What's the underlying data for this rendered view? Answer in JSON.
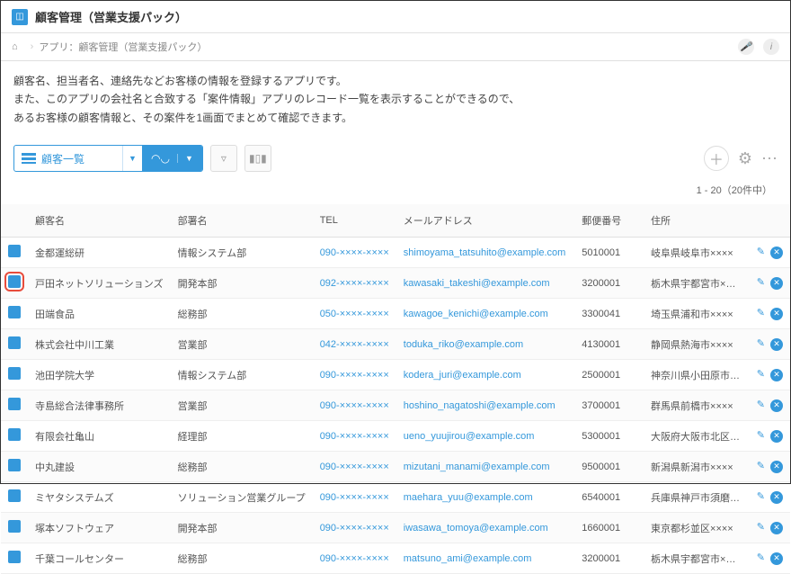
{
  "header": {
    "title": "顧客管理（営業支援パック）"
  },
  "breadcrumb": {
    "app_label": "アプリ：顧客管理（営業支援パック）"
  },
  "description": {
    "line1": "顧客名、担当者名、連絡先などお客様の情報を登録するアプリです。",
    "line2": "また、このアプリの会社名と合致する「案件情報」アプリのレコード一覧を表示することができるので、",
    "line3": "あるお客様の顧客情報と、その案件を1画面でまとめて確認できます。"
  },
  "view": {
    "name": "顧客一覧"
  },
  "pagination": {
    "text": "1 - 20（20件中）"
  },
  "columns": {
    "customer": "顧客名",
    "dept": "部署名",
    "tel": "TEL",
    "email": "メールアドレス",
    "postal": "郵便番号",
    "address": "住所"
  },
  "rows": [
    {
      "customer": "金都運総研",
      "dept": "情報システム部",
      "tel": "090-××××-××××",
      "email": "shimoyama_tatsuhito@example.com",
      "postal": "5010001",
      "address": "岐阜県岐阜市××××",
      "highlight": false
    },
    {
      "customer": "戸田ネットソリューションズ",
      "dept": "開発本部",
      "tel": "092-××××-××××",
      "email": "kawasaki_takeshi@example.com",
      "postal": "3200001",
      "address": "栃木県宇都宮市×…",
      "highlight": true
    },
    {
      "customer": "田端食品",
      "dept": "総務部",
      "tel": "050-××××-××××",
      "email": "kawagoe_kenichi@example.com",
      "postal": "3300041",
      "address": "埼玉県浦和市××××",
      "highlight": false
    },
    {
      "customer": "株式会社中川工業",
      "dept": "営業部",
      "tel": "042-××××-××××",
      "email": "toduka_riko@example.com",
      "postal": "4130001",
      "address": "静岡県熱海市××××",
      "highlight": false
    },
    {
      "customer": "池田学院大学",
      "dept": "情報システム部",
      "tel": "090-××××-××××",
      "email": "kodera_juri@example.com",
      "postal": "2500001",
      "address": "神奈川県小田原市…",
      "highlight": false
    },
    {
      "customer": "寺島総合法律事務所",
      "dept": "営業部",
      "tel": "090-××××-××××",
      "email": "hoshino_nagatoshi@example.com",
      "postal": "3700001",
      "address": "群馬県前橋市××××",
      "highlight": false
    },
    {
      "customer": "有限会社亀山",
      "dept": "経理部",
      "tel": "090-××××-××××",
      "email": "ueno_yuujirou@example.com",
      "postal": "5300001",
      "address": "大阪府大阪市北区…",
      "highlight": false
    },
    {
      "customer": "中丸建設",
      "dept": "総務部",
      "tel": "090-××××-××××",
      "email": "mizutani_manami@example.com",
      "postal": "9500001",
      "address": "新潟県新潟市××××",
      "highlight": false
    },
    {
      "customer": "ミヤタシステムズ",
      "dept": "ソリューション営業グループ",
      "tel": "090-××××-××××",
      "email": "maehara_yuu@example.com",
      "postal": "6540001",
      "address": "兵庫県神戸市須磨…",
      "highlight": false
    },
    {
      "customer": "塚本ソフトウェア",
      "dept": "開発本部",
      "tel": "090-××××-××××",
      "email": "iwasawa_tomoya@example.com",
      "postal": "1660001",
      "address": "東京都杉並区××××",
      "highlight": false
    },
    {
      "customer": "千葉コールセンター",
      "dept": "総務部",
      "tel": "090-××××-××××",
      "email": "matsuno_ami@example.com",
      "postal": "3200001",
      "address": "栃木県宇都宮市×…",
      "highlight": false
    }
  ]
}
